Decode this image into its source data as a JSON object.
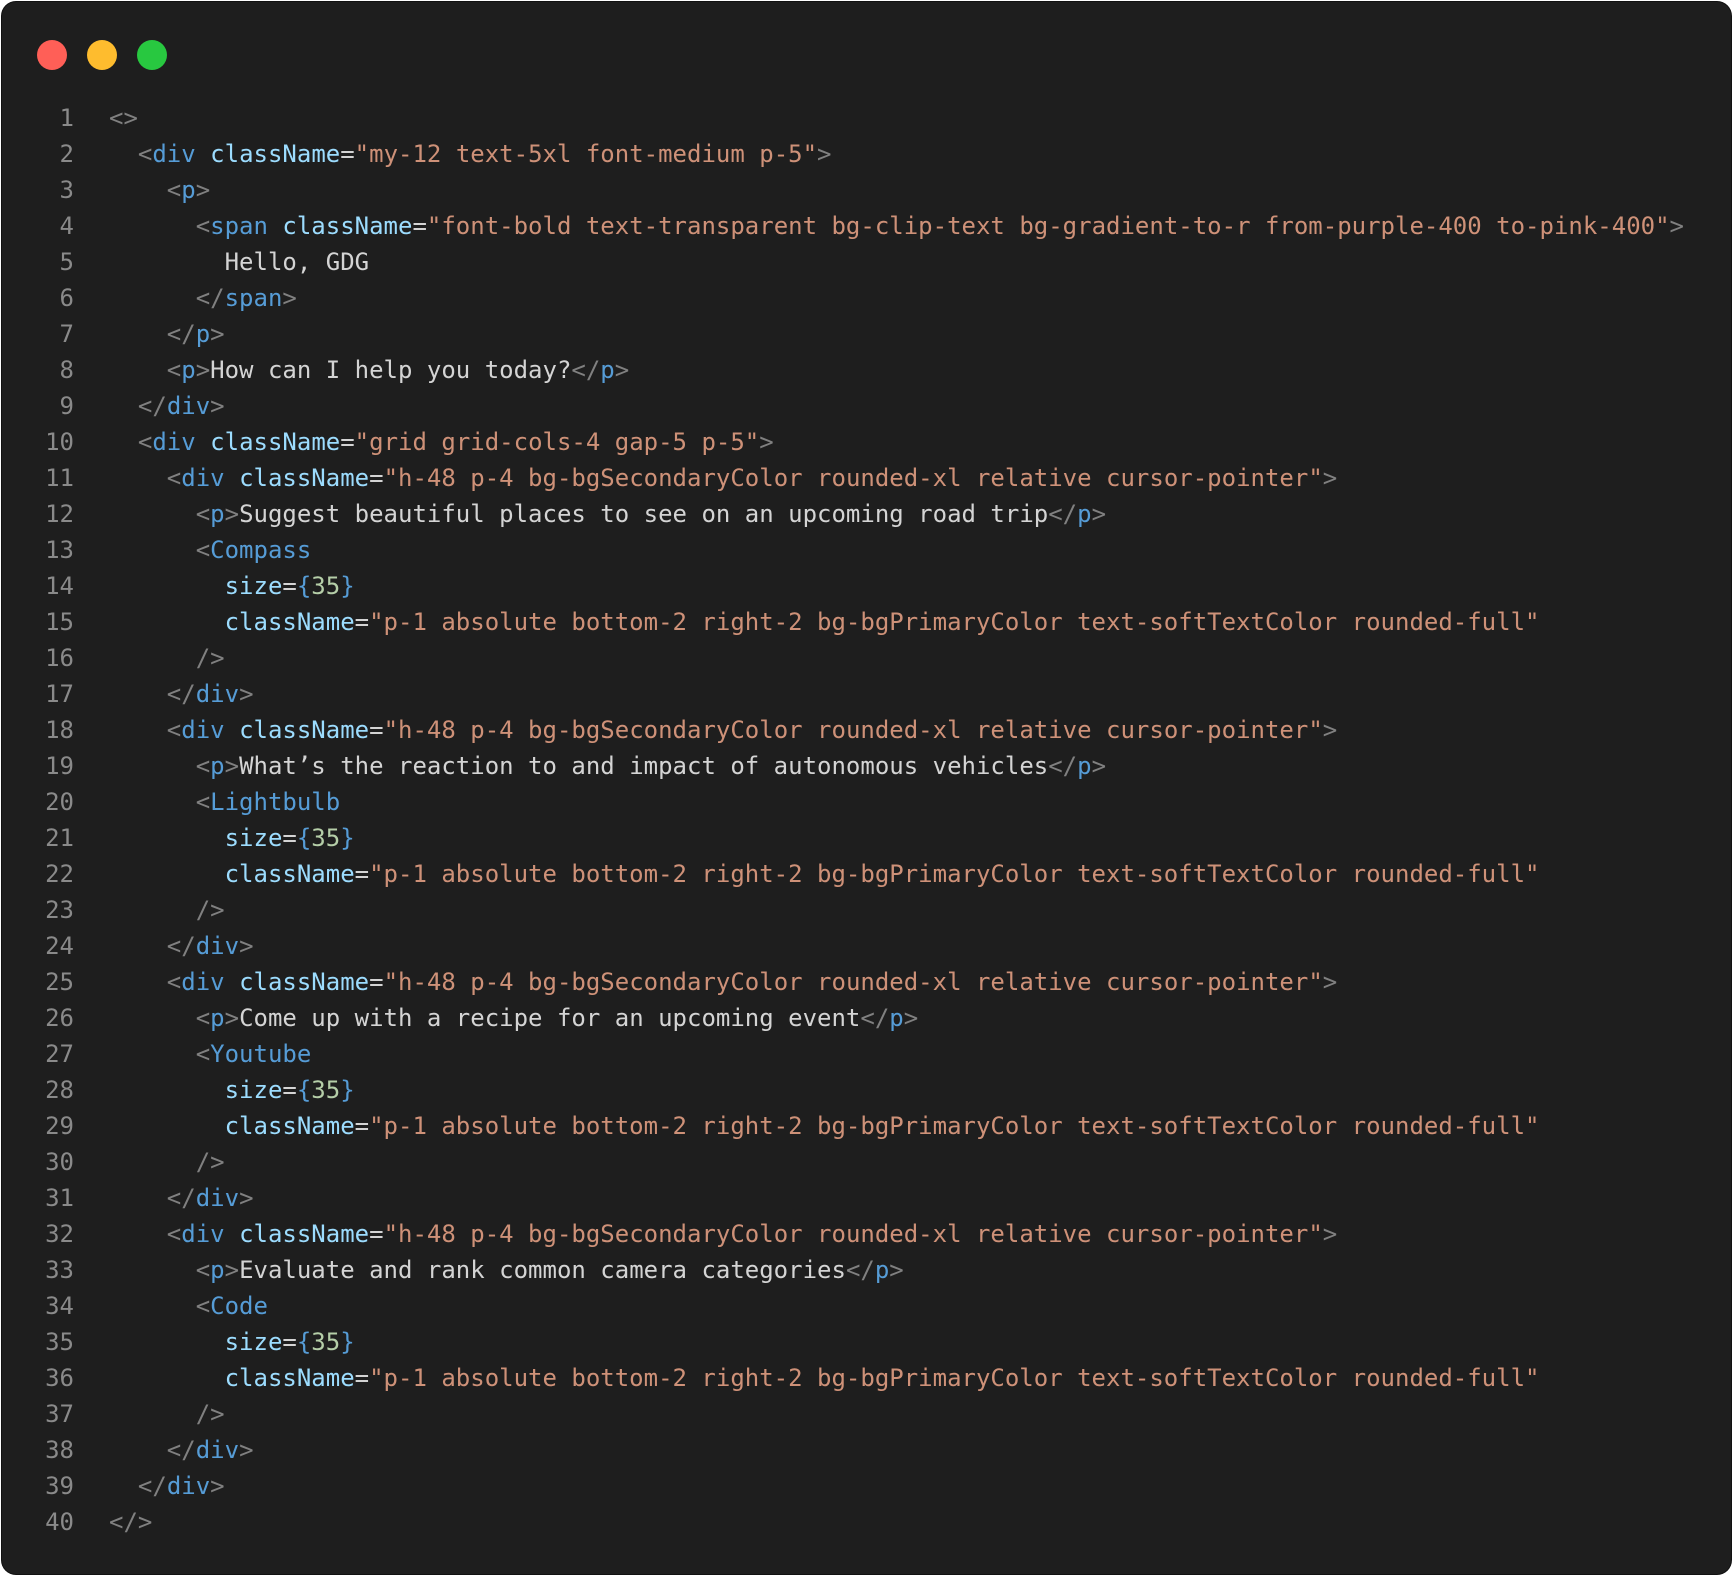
{
  "window": {
    "controls": [
      {
        "name": "close",
        "color": "#ff5f57"
      },
      {
        "name": "minimize",
        "color": "#febc2e"
      },
      {
        "name": "maximize",
        "color": "#28c840"
      }
    ]
  },
  "code": {
    "lines": [
      [
        {
          "t": "punct",
          "v": "<>"
        }
      ],
      [
        {
          "t": "text",
          "v": "  "
        },
        {
          "t": "punct",
          "v": "<"
        },
        {
          "t": "tag",
          "v": "div"
        },
        {
          "t": "text",
          "v": " "
        },
        {
          "t": "attr",
          "v": "className"
        },
        {
          "t": "op",
          "v": "="
        },
        {
          "t": "str",
          "v": "\"my-12 text-5xl font-medium p-5\""
        },
        {
          "t": "punct",
          "v": ">"
        }
      ],
      [
        {
          "t": "text",
          "v": "    "
        },
        {
          "t": "punct",
          "v": "<"
        },
        {
          "t": "tag",
          "v": "p"
        },
        {
          "t": "punct",
          "v": ">"
        }
      ],
      [
        {
          "t": "text",
          "v": "      "
        },
        {
          "t": "punct",
          "v": "<"
        },
        {
          "t": "tag",
          "v": "span"
        },
        {
          "t": "text",
          "v": " "
        },
        {
          "t": "attr",
          "v": "className"
        },
        {
          "t": "op",
          "v": "="
        },
        {
          "t": "str",
          "v": "\"font-bold text-transparent bg-clip-text bg-gradient-to-r from-purple-400 to-pink-400\""
        },
        {
          "t": "punct",
          "v": ">"
        }
      ],
      [
        {
          "t": "text",
          "v": "        Hello, GDG"
        }
      ],
      [
        {
          "t": "text",
          "v": "      "
        },
        {
          "t": "punct",
          "v": "</"
        },
        {
          "t": "tag",
          "v": "span"
        },
        {
          "t": "punct",
          "v": ">"
        }
      ],
      [
        {
          "t": "text",
          "v": "    "
        },
        {
          "t": "punct",
          "v": "</"
        },
        {
          "t": "tag",
          "v": "p"
        },
        {
          "t": "punct",
          "v": ">"
        }
      ],
      [
        {
          "t": "text",
          "v": "    "
        },
        {
          "t": "punct",
          "v": "<"
        },
        {
          "t": "tag",
          "v": "p"
        },
        {
          "t": "punct",
          "v": ">"
        },
        {
          "t": "text",
          "v": "How can I help you today?"
        },
        {
          "t": "punct",
          "v": "</"
        },
        {
          "t": "tag",
          "v": "p"
        },
        {
          "t": "punct",
          "v": ">"
        }
      ],
      [
        {
          "t": "text",
          "v": "  "
        },
        {
          "t": "punct",
          "v": "</"
        },
        {
          "t": "tag",
          "v": "div"
        },
        {
          "t": "punct",
          "v": ">"
        }
      ],
      [
        {
          "t": "text",
          "v": "  "
        },
        {
          "t": "punct",
          "v": "<"
        },
        {
          "t": "tag",
          "v": "div"
        },
        {
          "t": "text",
          "v": " "
        },
        {
          "t": "attr",
          "v": "className"
        },
        {
          "t": "op",
          "v": "="
        },
        {
          "t": "str",
          "v": "\"grid grid-cols-4 gap-5 p-5\""
        },
        {
          "t": "punct",
          "v": ">"
        }
      ],
      [
        {
          "t": "text",
          "v": "    "
        },
        {
          "t": "punct",
          "v": "<"
        },
        {
          "t": "tag",
          "v": "div"
        },
        {
          "t": "text",
          "v": " "
        },
        {
          "t": "attr",
          "v": "className"
        },
        {
          "t": "op",
          "v": "="
        },
        {
          "t": "str",
          "v": "\"h-48 p-4 bg-bgSecondaryColor rounded-xl relative cursor-pointer\""
        },
        {
          "t": "punct",
          "v": ">"
        }
      ],
      [
        {
          "t": "text",
          "v": "      "
        },
        {
          "t": "punct",
          "v": "<"
        },
        {
          "t": "tag",
          "v": "p"
        },
        {
          "t": "punct",
          "v": ">"
        },
        {
          "t": "text",
          "v": "Suggest beautiful places to see on an upcoming road trip"
        },
        {
          "t": "punct",
          "v": "</"
        },
        {
          "t": "tag",
          "v": "p"
        },
        {
          "t": "punct",
          "v": ">"
        }
      ],
      [
        {
          "t": "text",
          "v": "      "
        },
        {
          "t": "punct",
          "v": "<"
        },
        {
          "t": "tag",
          "v": "Compass"
        }
      ],
      [
        {
          "t": "text",
          "v": "        "
        },
        {
          "t": "attr",
          "v": "size"
        },
        {
          "t": "op",
          "v": "="
        },
        {
          "t": "brace",
          "v": "{"
        },
        {
          "t": "num",
          "v": "35"
        },
        {
          "t": "brace",
          "v": "}"
        }
      ],
      [
        {
          "t": "text",
          "v": "        "
        },
        {
          "t": "attr",
          "v": "className"
        },
        {
          "t": "op",
          "v": "="
        },
        {
          "t": "str",
          "v": "\"p-1 absolute bottom-2 right-2 bg-bgPrimaryColor text-softTextColor rounded-full\""
        }
      ],
      [
        {
          "t": "text",
          "v": "      "
        },
        {
          "t": "punct",
          "v": "/>"
        }
      ],
      [
        {
          "t": "text",
          "v": "    "
        },
        {
          "t": "punct",
          "v": "</"
        },
        {
          "t": "tag",
          "v": "div"
        },
        {
          "t": "punct",
          "v": ">"
        }
      ],
      [
        {
          "t": "text",
          "v": "    "
        },
        {
          "t": "punct",
          "v": "<"
        },
        {
          "t": "tag",
          "v": "div"
        },
        {
          "t": "text",
          "v": " "
        },
        {
          "t": "attr",
          "v": "className"
        },
        {
          "t": "op",
          "v": "="
        },
        {
          "t": "str",
          "v": "\"h-48 p-4 bg-bgSecondaryColor rounded-xl relative cursor-pointer\""
        },
        {
          "t": "punct",
          "v": ">"
        }
      ],
      [
        {
          "t": "text",
          "v": "      "
        },
        {
          "t": "punct",
          "v": "<"
        },
        {
          "t": "tag",
          "v": "p"
        },
        {
          "t": "punct",
          "v": ">"
        },
        {
          "t": "text",
          "v": "What’s the reaction to and impact of autonomous vehicles"
        },
        {
          "t": "punct",
          "v": "</"
        },
        {
          "t": "tag",
          "v": "p"
        },
        {
          "t": "punct",
          "v": ">"
        }
      ],
      [
        {
          "t": "text",
          "v": "      "
        },
        {
          "t": "punct",
          "v": "<"
        },
        {
          "t": "tag",
          "v": "Lightbulb"
        }
      ],
      [
        {
          "t": "text",
          "v": "        "
        },
        {
          "t": "attr",
          "v": "size"
        },
        {
          "t": "op",
          "v": "="
        },
        {
          "t": "brace",
          "v": "{"
        },
        {
          "t": "num",
          "v": "35"
        },
        {
          "t": "brace",
          "v": "}"
        }
      ],
      [
        {
          "t": "text",
          "v": "        "
        },
        {
          "t": "attr",
          "v": "className"
        },
        {
          "t": "op",
          "v": "="
        },
        {
          "t": "str",
          "v": "\"p-1 absolute bottom-2 right-2 bg-bgPrimaryColor text-softTextColor rounded-full\""
        }
      ],
      [
        {
          "t": "text",
          "v": "      "
        },
        {
          "t": "punct",
          "v": "/>"
        }
      ],
      [
        {
          "t": "text",
          "v": "    "
        },
        {
          "t": "punct",
          "v": "</"
        },
        {
          "t": "tag",
          "v": "div"
        },
        {
          "t": "punct",
          "v": ">"
        }
      ],
      [
        {
          "t": "text",
          "v": "    "
        },
        {
          "t": "punct",
          "v": "<"
        },
        {
          "t": "tag",
          "v": "div"
        },
        {
          "t": "text",
          "v": " "
        },
        {
          "t": "attr",
          "v": "className"
        },
        {
          "t": "op",
          "v": "="
        },
        {
          "t": "str",
          "v": "\"h-48 p-4 bg-bgSecondaryColor rounded-xl relative cursor-pointer\""
        },
        {
          "t": "punct",
          "v": ">"
        }
      ],
      [
        {
          "t": "text",
          "v": "      "
        },
        {
          "t": "punct",
          "v": "<"
        },
        {
          "t": "tag",
          "v": "p"
        },
        {
          "t": "punct",
          "v": ">"
        },
        {
          "t": "text",
          "v": "Come up with a recipe for an upcoming event"
        },
        {
          "t": "punct",
          "v": "</"
        },
        {
          "t": "tag",
          "v": "p"
        },
        {
          "t": "punct",
          "v": ">"
        }
      ],
      [
        {
          "t": "text",
          "v": "      "
        },
        {
          "t": "punct",
          "v": "<"
        },
        {
          "t": "tag",
          "v": "Youtube"
        }
      ],
      [
        {
          "t": "text",
          "v": "        "
        },
        {
          "t": "attr",
          "v": "size"
        },
        {
          "t": "op",
          "v": "="
        },
        {
          "t": "brace",
          "v": "{"
        },
        {
          "t": "num",
          "v": "35"
        },
        {
          "t": "brace",
          "v": "}"
        }
      ],
      [
        {
          "t": "text",
          "v": "        "
        },
        {
          "t": "attr",
          "v": "className"
        },
        {
          "t": "op",
          "v": "="
        },
        {
          "t": "str",
          "v": "\"p-1 absolute bottom-2 right-2 bg-bgPrimaryColor text-softTextColor rounded-full\""
        }
      ],
      [
        {
          "t": "text",
          "v": "      "
        },
        {
          "t": "punct",
          "v": "/>"
        }
      ],
      [
        {
          "t": "text",
          "v": "    "
        },
        {
          "t": "punct",
          "v": "</"
        },
        {
          "t": "tag",
          "v": "div"
        },
        {
          "t": "punct",
          "v": ">"
        }
      ],
      [
        {
          "t": "text",
          "v": "    "
        },
        {
          "t": "punct",
          "v": "<"
        },
        {
          "t": "tag",
          "v": "div"
        },
        {
          "t": "text",
          "v": " "
        },
        {
          "t": "attr",
          "v": "className"
        },
        {
          "t": "op",
          "v": "="
        },
        {
          "t": "str",
          "v": "\"h-48 p-4 bg-bgSecondaryColor rounded-xl relative cursor-pointer\""
        },
        {
          "t": "punct",
          "v": ">"
        }
      ],
      [
        {
          "t": "text",
          "v": "      "
        },
        {
          "t": "punct",
          "v": "<"
        },
        {
          "t": "tag",
          "v": "p"
        },
        {
          "t": "punct",
          "v": ">"
        },
        {
          "t": "text",
          "v": "Evaluate and rank common camera categories"
        },
        {
          "t": "punct",
          "v": "</"
        },
        {
          "t": "tag",
          "v": "p"
        },
        {
          "t": "punct",
          "v": ">"
        }
      ],
      [
        {
          "t": "text",
          "v": "      "
        },
        {
          "t": "punct",
          "v": "<"
        },
        {
          "t": "tag",
          "v": "Code"
        }
      ],
      [
        {
          "t": "text",
          "v": "        "
        },
        {
          "t": "attr",
          "v": "size"
        },
        {
          "t": "op",
          "v": "="
        },
        {
          "t": "brace",
          "v": "{"
        },
        {
          "t": "num",
          "v": "35"
        },
        {
          "t": "brace",
          "v": "}"
        }
      ],
      [
        {
          "t": "text",
          "v": "        "
        },
        {
          "t": "attr",
          "v": "className"
        },
        {
          "t": "op",
          "v": "="
        },
        {
          "t": "str",
          "v": "\"p-1 absolute bottom-2 right-2 bg-bgPrimaryColor text-softTextColor rounded-full\""
        }
      ],
      [
        {
          "t": "text",
          "v": "      "
        },
        {
          "t": "punct",
          "v": "/>"
        }
      ],
      [
        {
          "t": "text",
          "v": "    "
        },
        {
          "t": "punct",
          "v": "</"
        },
        {
          "t": "tag",
          "v": "div"
        },
        {
          "t": "punct",
          "v": ">"
        }
      ],
      [
        {
          "t": "text",
          "v": "  "
        },
        {
          "t": "punct",
          "v": "</"
        },
        {
          "t": "tag",
          "v": "div"
        },
        {
          "t": "punct",
          "v": ">"
        }
      ],
      [
        {
          "t": "punct",
          "v": "</>"
        }
      ]
    ]
  }
}
